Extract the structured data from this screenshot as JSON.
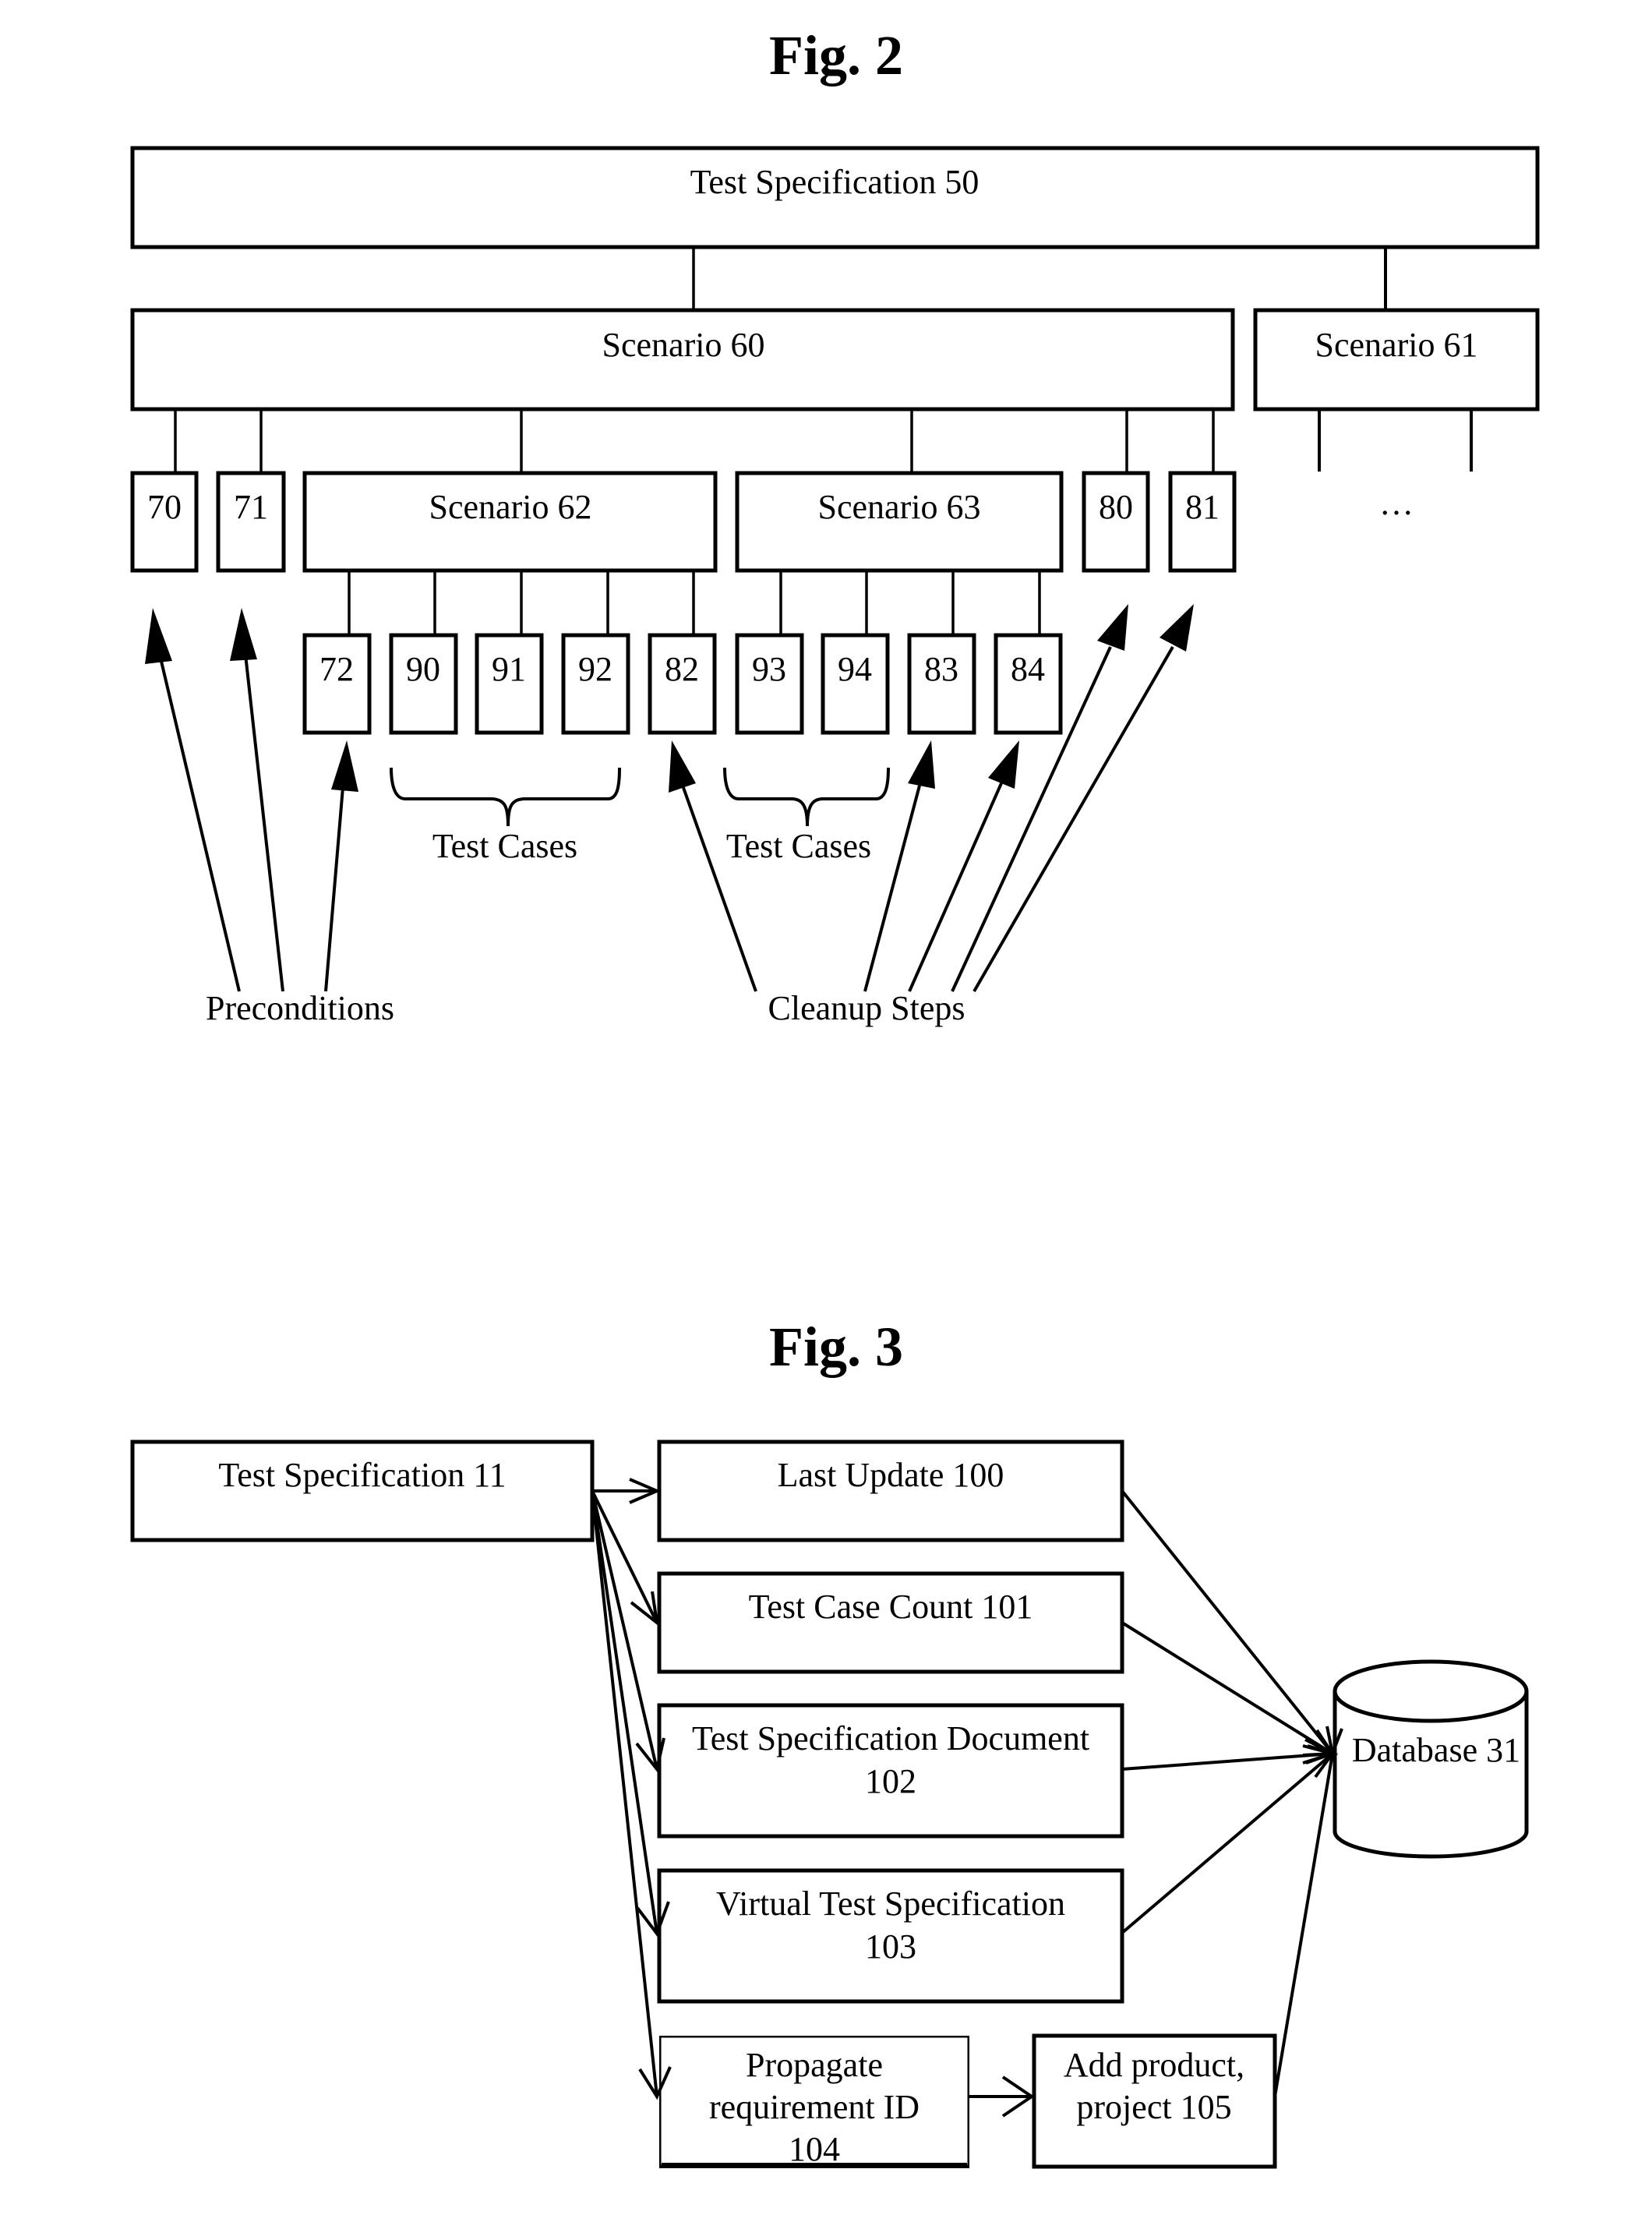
{
  "fig2": {
    "title": "Fig. 2",
    "test_spec": "Test Specification 50",
    "scenario_60": "Scenario 60",
    "scenario_61": "Scenario 61",
    "scenario_62": "Scenario 62",
    "scenario_63": "Scenario 63",
    "scenario_61_children": "…",
    "boxes": {
      "b70": "70",
      "b71": "71",
      "b80": "80",
      "b81": "81",
      "b72": "72",
      "b90": "90",
      "b91": "91",
      "b92": "92",
      "b82": "82",
      "b93": "93",
      "b94": "94",
      "b83": "83",
      "b84": "84"
    },
    "labels": {
      "test_cases_1": "Test Cases",
      "test_cases_2": "Test Cases",
      "preconditions": "Preconditions",
      "cleanup_steps": "Cleanup Steps"
    }
  },
  "fig3": {
    "title": "Fig. 3",
    "test_spec": "Test Specification 11",
    "last_update": "Last Update 100",
    "test_case_count": "Test Case Count 101",
    "ts_document_line1": "Test Specification Document",
    "ts_document_line2": "102",
    "virtual_ts_line1": "Virtual Test Specification",
    "virtual_ts_line2": "103",
    "propagate_line1": "Propagate",
    "propagate_line2": "requirement ID",
    "propagate_line3": "104",
    "add_product_line1": "Add product,",
    "add_product_line2": "project 105",
    "database": "Database 31"
  }
}
